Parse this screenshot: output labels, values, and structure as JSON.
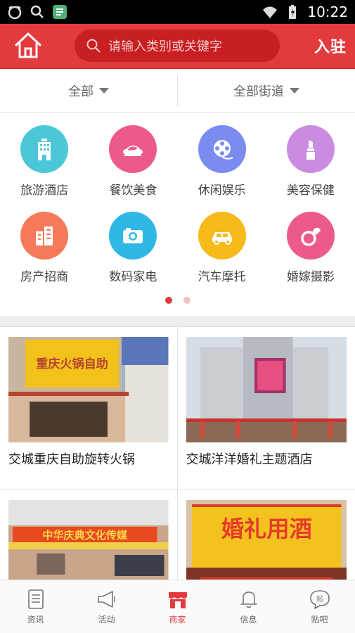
{
  "status": {
    "time": "10:22"
  },
  "header": {
    "search_placeholder": "请输入类别或关键字",
    "join_label": "入驻"
  },
  "filters": {
    "all": "全部",
    "street": "全部街道"
  },
  "categories": [
    {
      "label": "旅游酒店",
      "color": "#4cc7d8",
      "icon": "hotel-icon"
    },
    {
      "label": "餐饮美食",
      "color": "#ec5a8d",
      "icon": "food-icon"
    },
    {
      "label": "休闲娱乐",
      "color": "#7b8bf0",
      "icon": "film-reel-icon"
    },
    {
      "label": "美容保健",
      "color": "#c98ce0",
      "icon": "lipstick-icon"
    },
    {
      "label": "房产招商",
      "color": "#f67a5a",
      "icon": "building-icon"
    },
    {
      "label": "数码家电",
      "color": "#2fb8e6",
      "icon": "camera-icon"
    },
    {
      "label": "汽车摩托",
      "color": "#f6bb1a",
      "icon": "car-icon"
    },
    {
      "label": "婚嫁摄影",
      "color": "#ec5a8d",
      "icon": "ring-icon"
    }
  ],
  "pager": {
    "active_color": "#e33a3d",
    "inactive_color": "#f3c2c5"
  },
  "cards": [
    {
      "title": "交城重庆自助旋转火锅",
      "sign": "重庆火锅自助"
    },
    {
      "title": "交城洋洋婚礼主题酒店",
      "sign": ""
    },
    {
      "title": "",
      "sign": "中华庆典文化传媒"
    },
    {
      "title": "",
      "sign": "婚礼用酒"
    }
  ],
  "tabbar": [
    {
      "label": "资讯",
      "icon": "news-icon"
    },
    {
      "label": "活动",
      "icon": "megaphone-icon"
    },
    {
      "label": "商家",
      "icon": "shop-icon",
      "active": true
    },
    {
      "label": "信息",
      "icon": "bell-icon"
    },
    {
      "label": "贴吧",
      "icon": "chat-bubble-icon"
    }
  ]
}
